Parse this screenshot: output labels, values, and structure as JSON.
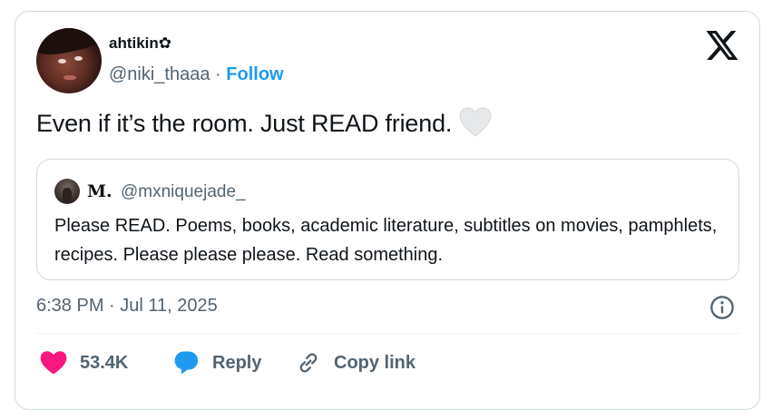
{
  "author": {
    "display_name": "ahtikin✿",
    "handle": "@niki_thaaa",
    "separator": "·",
    "follow_label": "Follow"
  },
  "tweet": {
    "text": "Even if it’s the room. Just READ friend."
  },
  "quoted": {
    "display_name": "𝐌.",
    "handle": "@mxniquejade_",
    "text": "Please READ. Poems, books, academic literature, subtitles on movies, pamphlets, recipes. Please please please. Read something."
  },
  "timestamp": "6:38 PM · Jul 11, 2025",
  "actions": {
    "like_count": "53.4K",
    "reply_label": "Reply",
    "copy_label": "Copy link"
  },
  "colors": {
    "accent": "#1d9bf0",
    "like": "#f91880",
    "reply_icon": "#1d9bf0",
    "muted_text": "#536471",
    "border": "#cfd9de"
  },
  "icons": [
    "x-logo-icon",
    "white-heart-emoji-icon",
    "info-icon",
    "heart-icon",
    "speech-bubble-icon",
    "link-icon"
  ]
}
